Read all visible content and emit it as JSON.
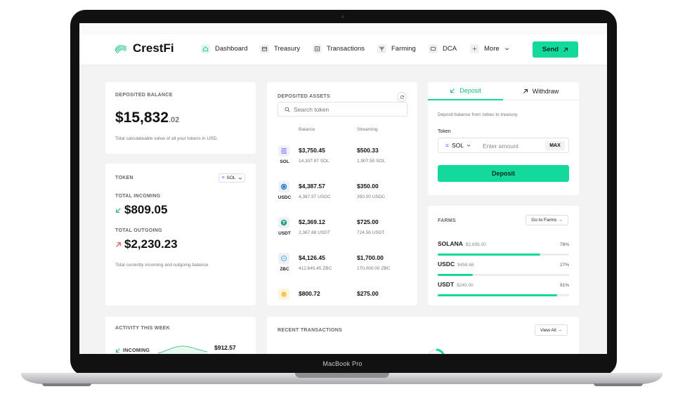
{
  "device_label": "MacBook Pro",
  "brand": {
    "name": "CrestFi"
  },
  "nav": {
    "items": [
      {
        "label": "Dashboard",
        "icon": "home-icon",
        "active": true
      },
      {
        "label": "Treasury",
        "icon": "treasury-icon"
      },
      {
        "label": "Transactions",
        "icon": "transactions-icon"
      },
      {
        "label": "Farming",
        "icon": "farming-icon"
      },
      {
        "label": "DCA",
        "icon": "dca-icon"
      },
      {
        "label": "More",
        "icon": "more-icon"
      }
    ],
    "send_label": "Send"
  },
  "deposited_balance": {
    "title": "DEPOSITED BALANCE",
    "amount": "$15,832",
    "cents": ".02",
    "description": "Total calculateable value of all your tokens in USD."
  },
  "token_card": {
    "title": "TOKEN",
    "selected_token": "SOL",
    "incoming_label": "TOTAL INCOMING",
    "incoming_value": "$809.05",
    "outgoing_label": "TOTAL OUTGOING",
    "outgoing_value": "$2,230.23",
    "description": "Total currently incoming and outgoing balance."
  },
  "deposited_assets": {
    "title": "DEPOSITED ASSETS",
    "search_placeholder": "Search token",
    "columns": {
      "balance": "Balance",
      "streaming": "Streaming"
    },
    "rows": [
      {
        "symbol": "SOL",
        "balance_usd": "$3,750.45",
        "balance_token": "14,307.97 SOL",
        "streaming_usd": "$500.33",
        "streaming_token": "1,907.50 SOL",
        "color": "#7b5cff"
      },
      {
        "symbol": "USDC",
        "balance_usd": "$4,387.57",
        "balance_token": "4,387.57 USDC",
        "streaming_usd": "$350.00",
        "streaming_token": "350.00 USDC",
        "color": "#2775ca"
      },
      {
        "symbol": "USDT",
        "balance_usd": "$2,369.12",
        "balance_token": "2,367.68 USDT",
        "streaming_usd": "$725.00",
        "streaming_token": "724.56 USDT",
        "color": "#26a17b"
      },
      {
        "symbol": "ZBC",
        "balance_usd": "$4,126.45",
        "balance_token": "412,645.45 ZBC",
        "streaming_usd": "$1,700.00",
        "streaming_token": "170,000.00 ZBC",
        "color": "#4aa3e0"
      },
      {
        "symbol": "",
        "balance_usd": "$800.72",
        "balance_token": "",
        "streaming_usd": "$275.00",
        "streaming_token": "",
        "color": "#f2c94c"
      }
    ]
  },
  "transfer": {
    "deposit_tab": "Deposit",
    "withdraw_tab": "Withdraw",
    "description": "Deposit balance from zebec to treasury.",
    "token_label": "Token",
    "token_selected": "SOL",
    "amount_placeholder": "Enter amount",
    "max_label": "MAX",
    "submit_label": "Deposit"
  },
  "farms": {
    "title": "FARMS",
    "go_label": "Go to Farms →",
    "rows": [
      {
        "name": "SOLANA",
        "value": "$2,895.00",
        "percent_label": "78%",
        "percent": 78
      },
      {
        "name": "USDC",
        "value": "$458.68",
        "percent_label": "27%",
        "percent": 27
      },
      {
        "name": "USDT",
        "value": "$245.00",
        "percent_label": "91%",
        "percent": 91
      }
    ]
  },
  "activity": {
    "title": "ACTIVITY THIS WEEK",
    "incoming_label": "INCOMING",
    "incoming_value": "$912.57"
  },
  "recent_transactions": {
    "title": "RECENT TRANSACTIONS",
    "view_all_label": "View All →"
  },
  "colors": {
    "accent": "#13d99a",
    "incoming": "#2bb673",
    "outgoing": "#e5484d"
  }
}
